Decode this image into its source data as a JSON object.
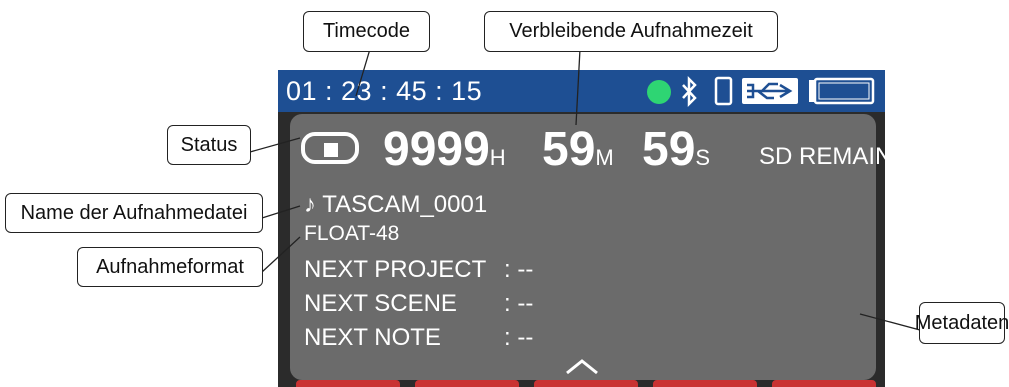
{
  "status_bar": {
    "timecode": "01 : 23 : 45 : 15",
    "icons": [
      "record-ready-dot-icon",
      "bluetooth-icon",
      "smartphone-icon",
      "usb-power-icon",
      "battery-icon"
    ],
    "colors": {
      "bar": "#1e4f93",
      "ready_dot": "#2ed573",
      "usb_highlight": "#ffffff"
    }
  },
  "main": {
    "status_icon": "stop-icon",
    "remain": {
      "hours": "9999",
      "hours_unit": "H",
      "minutes": "59",
      "minutes_unit": "M",
      "seconds": "59",
      "seconds_unit": "S",
      "label": "SD REMAIN"
    },
    "file_icon": "note-icon",
    "filename": "TASCAM_0001",
    "format": "FLOAT-48",
    "metadata": [
      {
        "key": "NEXT PROJECT",
        "sep": ":",
        "value": "--"
      },
      {
        "key": "NEXT SCENE",
        "sep": ":",
        "value": "--"
      },
      {
        "key": "NEXT NOTE",
        "sep": ":",
        "value": "--"
      }
    ],
    "scroll_icon": "chevron-up-icon"
  },
  "callouts": {
    "timecode": "Timecode",
    "remaining": "Verbleibende Aufnahmezeit",
    "status": "Status",
    "filename": "Name der Aufnahmedatei",
    "format": "Aufnahmeformat",
    "metadata": "Metadaten"
  }
}
